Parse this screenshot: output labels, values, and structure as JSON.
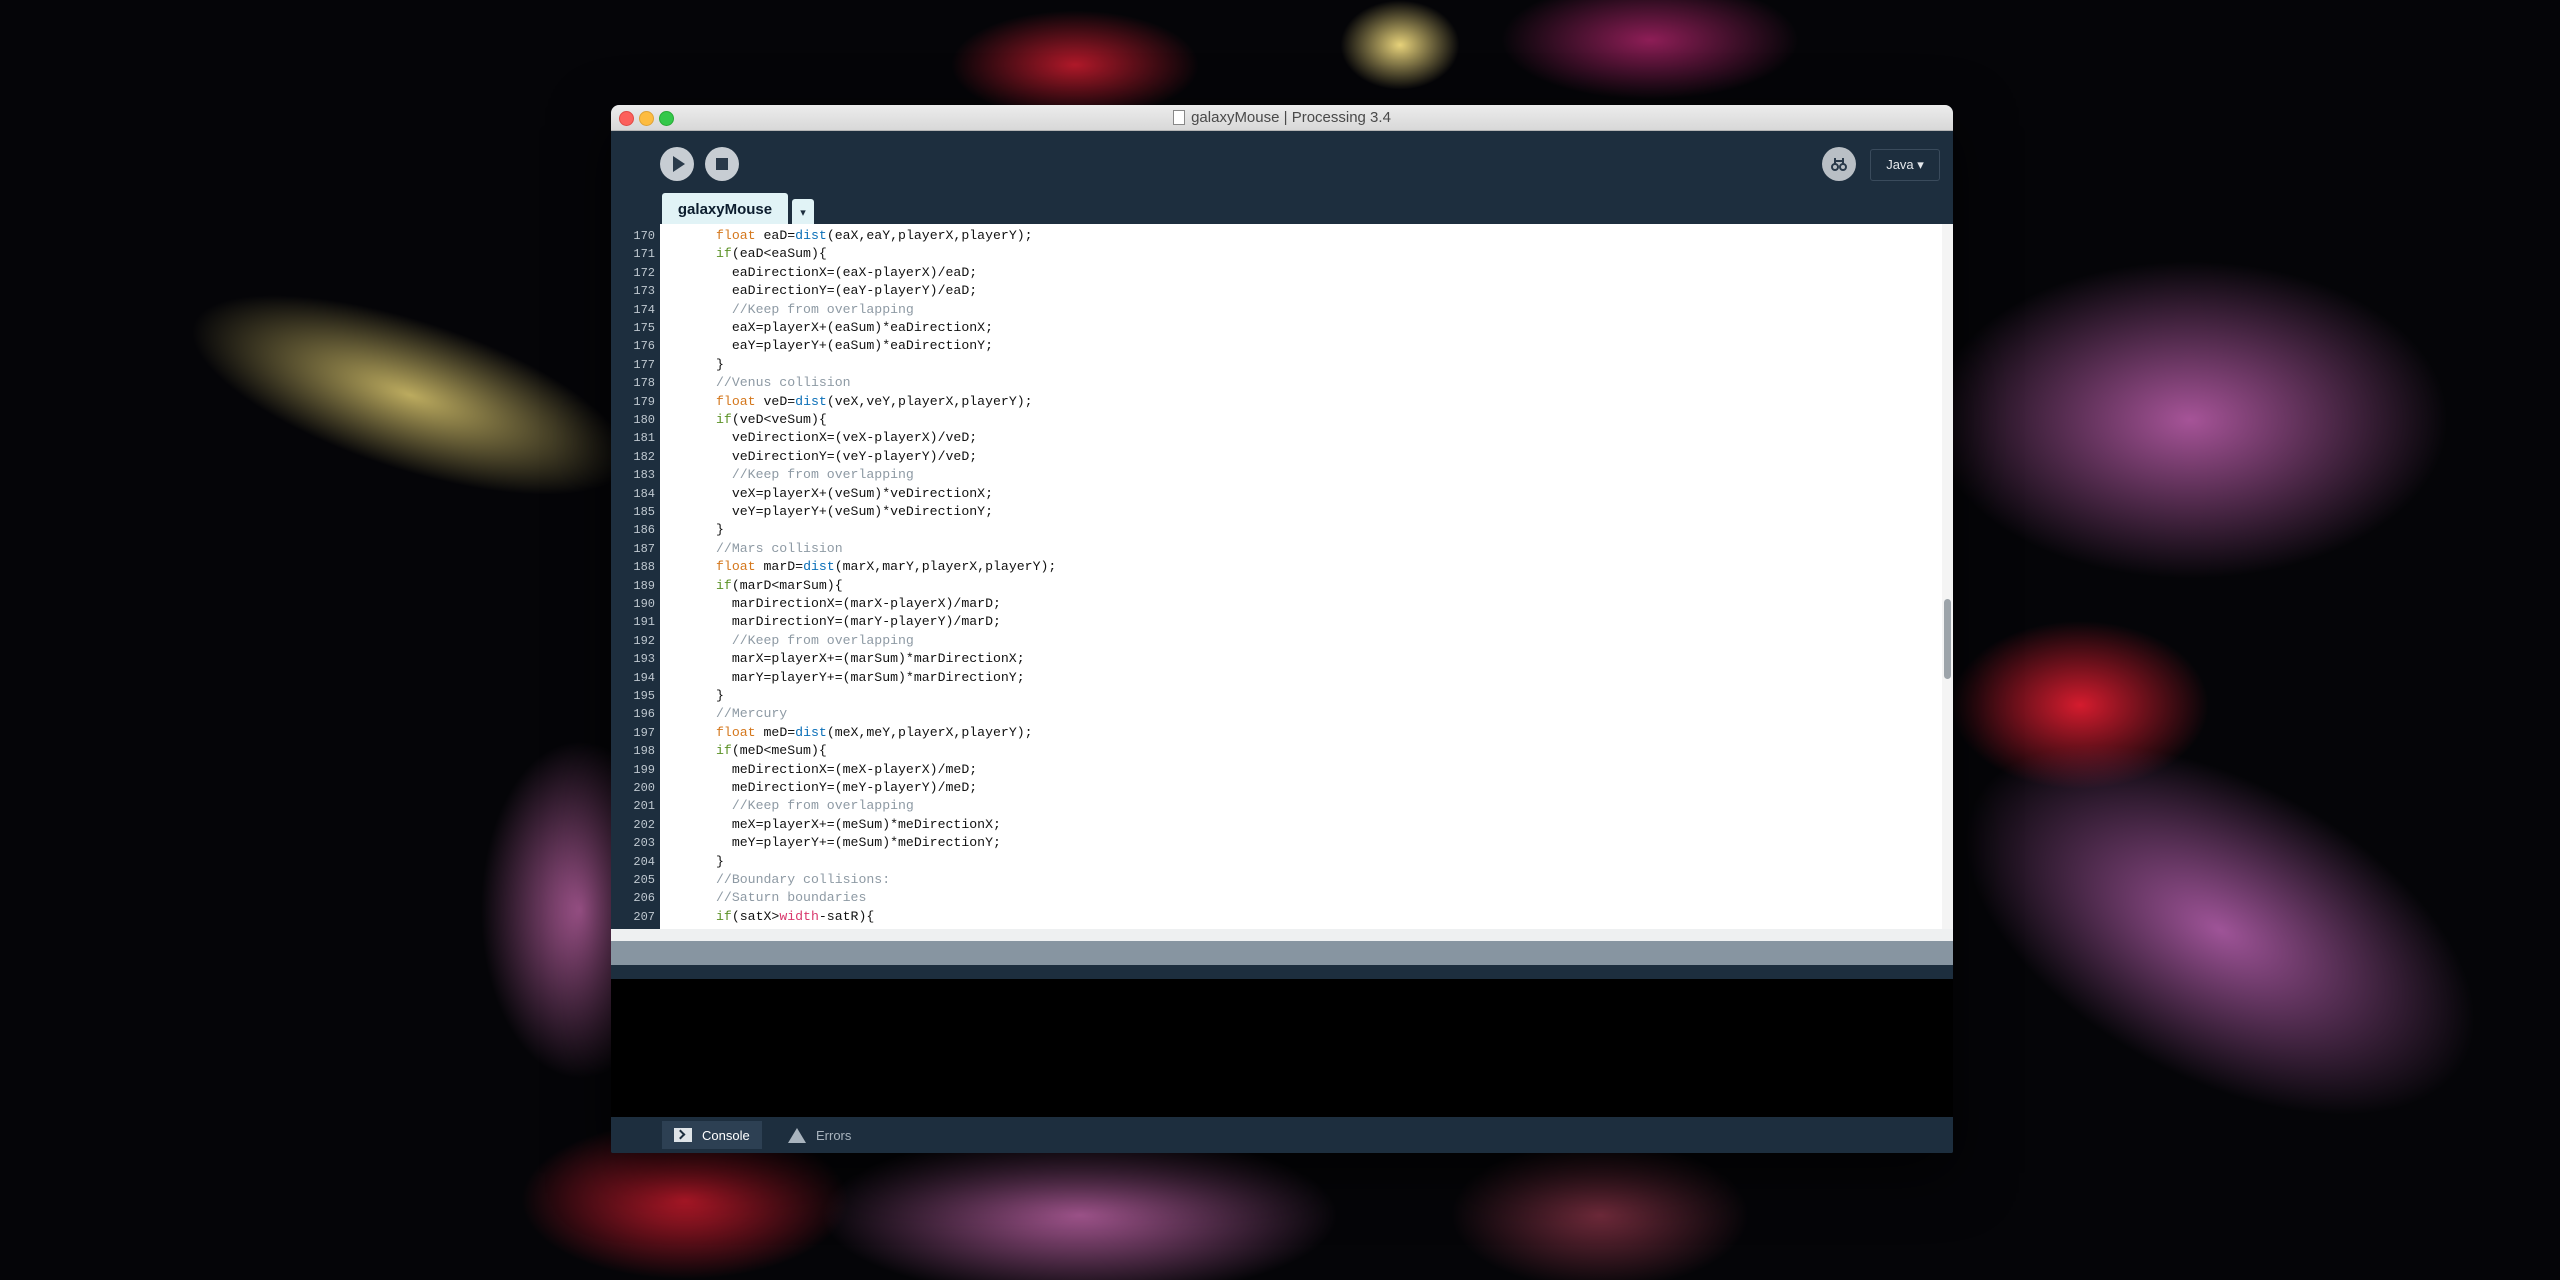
{
  "window": {
    "title": "galaxyMouse | Processing 3.4"
  },
  "toolbar": {
    "run_icon": "play-icon",
    "stop_icon": "stop-icon",
    "debug_icon": "debugger-icon",
    "mode_label": "Java ▾"
  },
  "tabs": {
    "active_tab": "galaxyMouse",
    "menu_label": "▾"
  },
  "editor": {
    "lines": [
      {
        "n": "170",
        "t": "float eaD=dist(eaX,eaY,playerX,playerY);"
      },
      {
        "n": "171",
        "t": "if(eaD<eaSum){"
      },
      {
        "n": "172",
        "t": "  eaDirectionX=(eaX-playerX)/eaD;"
      },
      {
        "n": "173",
        "t": "  eaDirectionY=(eaY-playerY)/eaD;"
      },
      {
        "n": "174",
        "t": "  //Keep from overlapping"
      },
      {
        "n": "175",
        "t": "  eaX=playerX+(eaSum)*eaDirectionX;"
      },
      {
        "n": "176",
        "t": "  eaY=playerY+(eaSum)*eaDirectionY;"
      },
      {
        "n": "177",
        "t": "}"
      },
      {
        "n": "178",
        "t": "//Venus collision"
      },
      {
        "n": "179",
        "t": "float veD=dist(veX,veY,playerX,playerY);"
      },
      {
        "n": "180",
        "t": "if(veD<veSum){"
      },
      {
        "n": "181",
        "t": "  veDirectionX=(veX-playerX)/veD;"
      },
      {
        "n": "182",
        "t": "  veDirectionY=(veY-playerY)/veD;"
      },
      {
        "n": "183",
        "t": "  //Keep from overlapping"
      },
      {
        "n": "184",
        "t": "  veX=playerX+(veSum)*veDirectionX;"
      },
      {
        "n": "185",
        "t": "  veY=playerY+(veSum)*veDirectionY;"
      },
      {
        "n": "186",
        "t": "}"
      },
      {
        "n": "187",
        "t": "//Mars collision"
      },
      {
        "n": "188",
        "t": "float marD=dist(marX,marY,playerX,playerY);"
      },
      {
        "n": "189",
        "t": "if(marD<marSum){"
      },
      {
        "n": "190",
        "t": "  marDirectionX=(marX-playerX)/marD;"
      },
      {
        "n": "191",
        "t": "  marDirectionY=(marY-playerY)/marD;"
      },
      {
        "n": "192",
        "t": "  //Keep from overlapping"
      },
      {
        "n": "193",
        "t": "  marX=playerX+=(marSum)*marDirectionX;"
      },
      {
        "n": "194",
        "t": "  marY=playerY+=(marSum)*marDirectionY;"
      },
      {
        "n": "195",
        "t": "}"
      },
      {
        "n": "196",
        "t": "//Mercury"
      },
      {
        "n": "197",
        "t": "float meD=dist(meX,meY,playerX,playerY);"
      },
      {
        "n": "198",
        "t": "if(meD<meSum){"
      },
      {
        "n": "199",
        "t": "  meDirectionX=(meX-playerX)/meD;"
      },
      {
        "n": "200",
        "t": "  meDirectionY=(meY-playerY)/meD;"
      },
      {
        "n": "201",
        "t": "  //Keep from overlapping"
      },
      {
        "n": "202",
        "t": "  meX=playerX+=(meSum)*meDirectionX;"
      },
      {
        "n": "203",
        "t": "  meY=playerY+=(meSum)*meDirectionY;"
      },
      {
        "n": "204",
        "t": "}"
      },
      {
        "n": "205",
        "t": "//Boundary collisions:"
      },
      {
        "n": "206",
        "t": "//Saturn boundaries"
      },
      {
        "n": "207",
        "t": "if(satX>width-satR){"
      }
    ]
  },
  "footer": {
    "console_label": "Console",
    "errors_label": "Errors"
  },
  "colors": {
    "chrome": "#1d2e3e",
    "tab_bg": "#e1f3f6",
    "keyword_type": "#d4771c",
    "keyword_control": "#5c9226",
    "function": "#0a6fb8",
    "comment": "#8e9aa4",
    "builtin_var": "#d9386d"
  }
}
